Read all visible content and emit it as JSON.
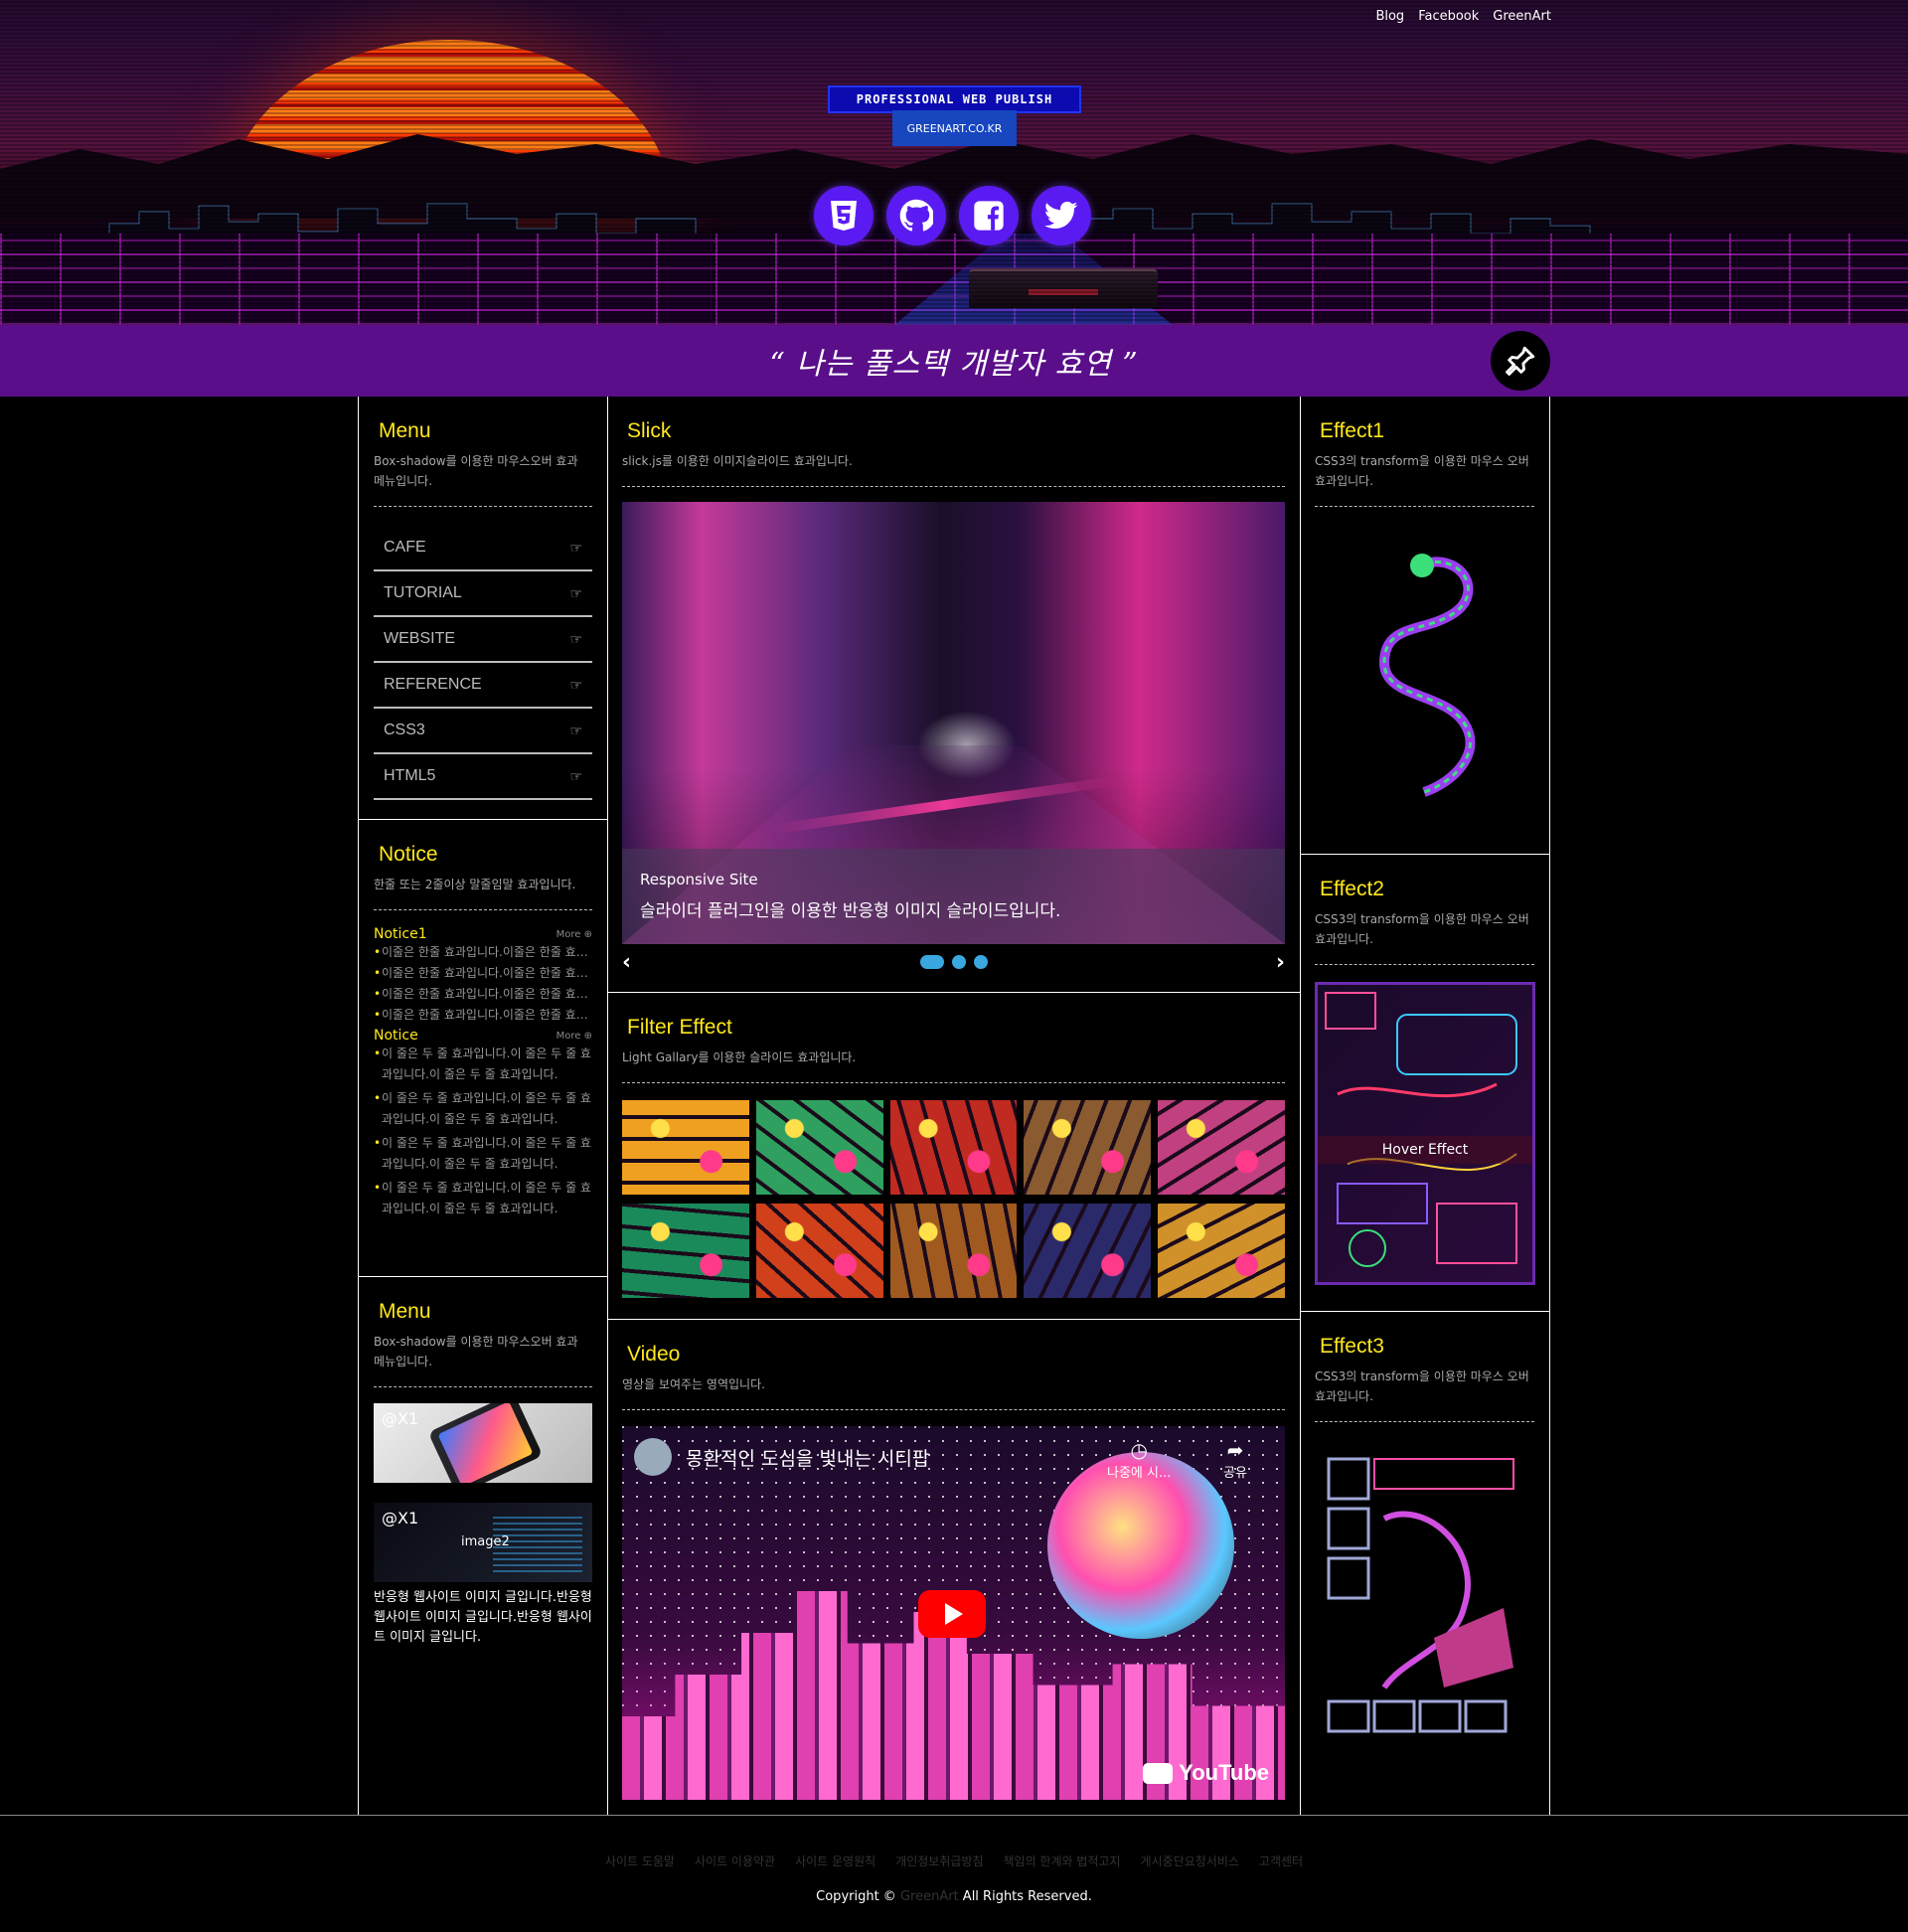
{
  "header": {
    "nav": [
      "Blog",
      "Facebook",
      "GreenArt"
    ],
    "badge_title": "PROFESSIONAL WEB PUBLISH",
    "badge_sub": "GREENART.CO.KR",
    "social": [
      "html5-icon",
      "github-icon",
      "facebook-icon",
      "twitter-icon"
    ]
  },
  "quote": "“ 나는 풀스택 개발자 효연 ”",
  "left": {
    "menu": {
      "title": "Menu",
      "desc": "Box-shadow를 이용한 마우스오버 효과 메뉴입니다.",
      "items": [
        "CAFE",
        "TUTORIAL",
        "WEBSITE",
        "REFERENCE",
        "CSS3",
        "HTML5"
      ]
    },
    "notice": {
      "title": "Notice",
      "desc": "한줄 또는 2줄이상 말줄임말 효과입니다.",
      "group1": {
        "title": "Notice1",
        "more": "More",
        "items": [
          "이줄은 한줄 효과입니다.이줄은 한줄 효과입니다.",
          "이줄은 한줄 효과입니다.이줄은 한줄 효과입니다.",
          "이줄은 한줄 효과입니다.이줄은 한줄 효과입니다.",
          "이줄은 한줄 효과입니다.이줄은 한줄 효과입니다."
        ]
      },
      "group2": {
        "title": "Notice",
        "more": "More",
        "items": [
          "이 줄은 두 줄 효과입니다.이 줄은 두 줄 효과입니다.이 줄은 두 줄 효과입니다.",
          "이 줄은 두 줄 효과입니다.이 줄은 두 줄 효과입니다.이 줄은 두 줄 효과입니다.",
          "이 줄은 두 줄 효과입니다.이 줄은 두 줄 효과입니다.이 줄은 두 줄 효과입니다.",
          "이 줄은 두 줄 효과입니다.이 줄은 두 줄 효과입니다.이 줄은 두 줄 효과입니다."
        ]
      }
    },
    "menu2": {
      "title": "Menu",
      "desc": "Box-shadow를 이용한 마우스오버 효과 메뉴입니다.",
      "img1_label": "@X1",
      "img2_label": "@X1",
      "img2_caption": "image2",
      "text": "반응형 웹사이트 이미지 글입니다.반응형 웹사이트 이미지 글입니다.반응형 웹사이트 이미지 글입니다."
    }
  },
  "center": {
    "slick": {
      "title": "Slick",
      "desc": "slick.js를 이용한 이미지슬라이드 효과입니다.",
      "caption_title": "Responsive Site",
      "caption_text": "슬라이더 플러그인을 이용한 반응형 이미지 슬라이드입니다.",
      "prev": "‹",
      "next": "›",
      "dots": 3,
      "active_dot": 1
    },
    "filter": {
      "title": "Filter Effect",
      "desc": "Light Gallary를 이용한 슬라이드 효과입니다.",
      "tiles": [
        "#f0a020",
        "#30a060",
        "#c02a20",
        "#8a5a30",
        "#c04080",
        "#1a8a5a",
        "#d0401a",
        "#a05a20",
        "#2a2a6a",
        "#d0902a"
      ]
    },
    "video": {
      "title": "Video",
      "desc": "영상을 보여주는 영역입니다.",
      "video_title": "몽환적인 도심을 빛내는 시티팝",
      "watch_later": "나중에 시...",
      "share": "공유",
      "brand": "YouTube"
    }
  },
  "right": {
    "effect1": {
      "title": "Effect1",
      "desc": "CSS3의 transform을 이용한 마우스 오버효과입니다."
    },
    "effect2": {
      "title": "Effect2",
      "desc": "CSS3의 transform을 이용한 마우스 오버효과입니다.",
      "hover": "Hover Effect"
    },
    "effect3": {
      "title": "Effect3",
      "desc": "CSS3의 transform을 이용한 마우스 오버효과입니다."
    }
  },
  "footer": {
    "links": [
      "사이트 도움말",
      "사이트 이용약관",
      "사이트 운영원칙",
      "개인정보취급방침",
      "책임의 한계와 법적고지",
      "게시중단요청서비스",
      "고객센터"
    ],
    "copy_pre": "Copyright ©",
    "copy_brand": "GreenArt",
    "copy_post": "All Rights Reserved."
  },
  "colors": {
    "accent_yellow": "#ffe81a",
    "purple_bar": "#5a0e8a",
    "social_bg": "#5a1bf2"
  }
}
